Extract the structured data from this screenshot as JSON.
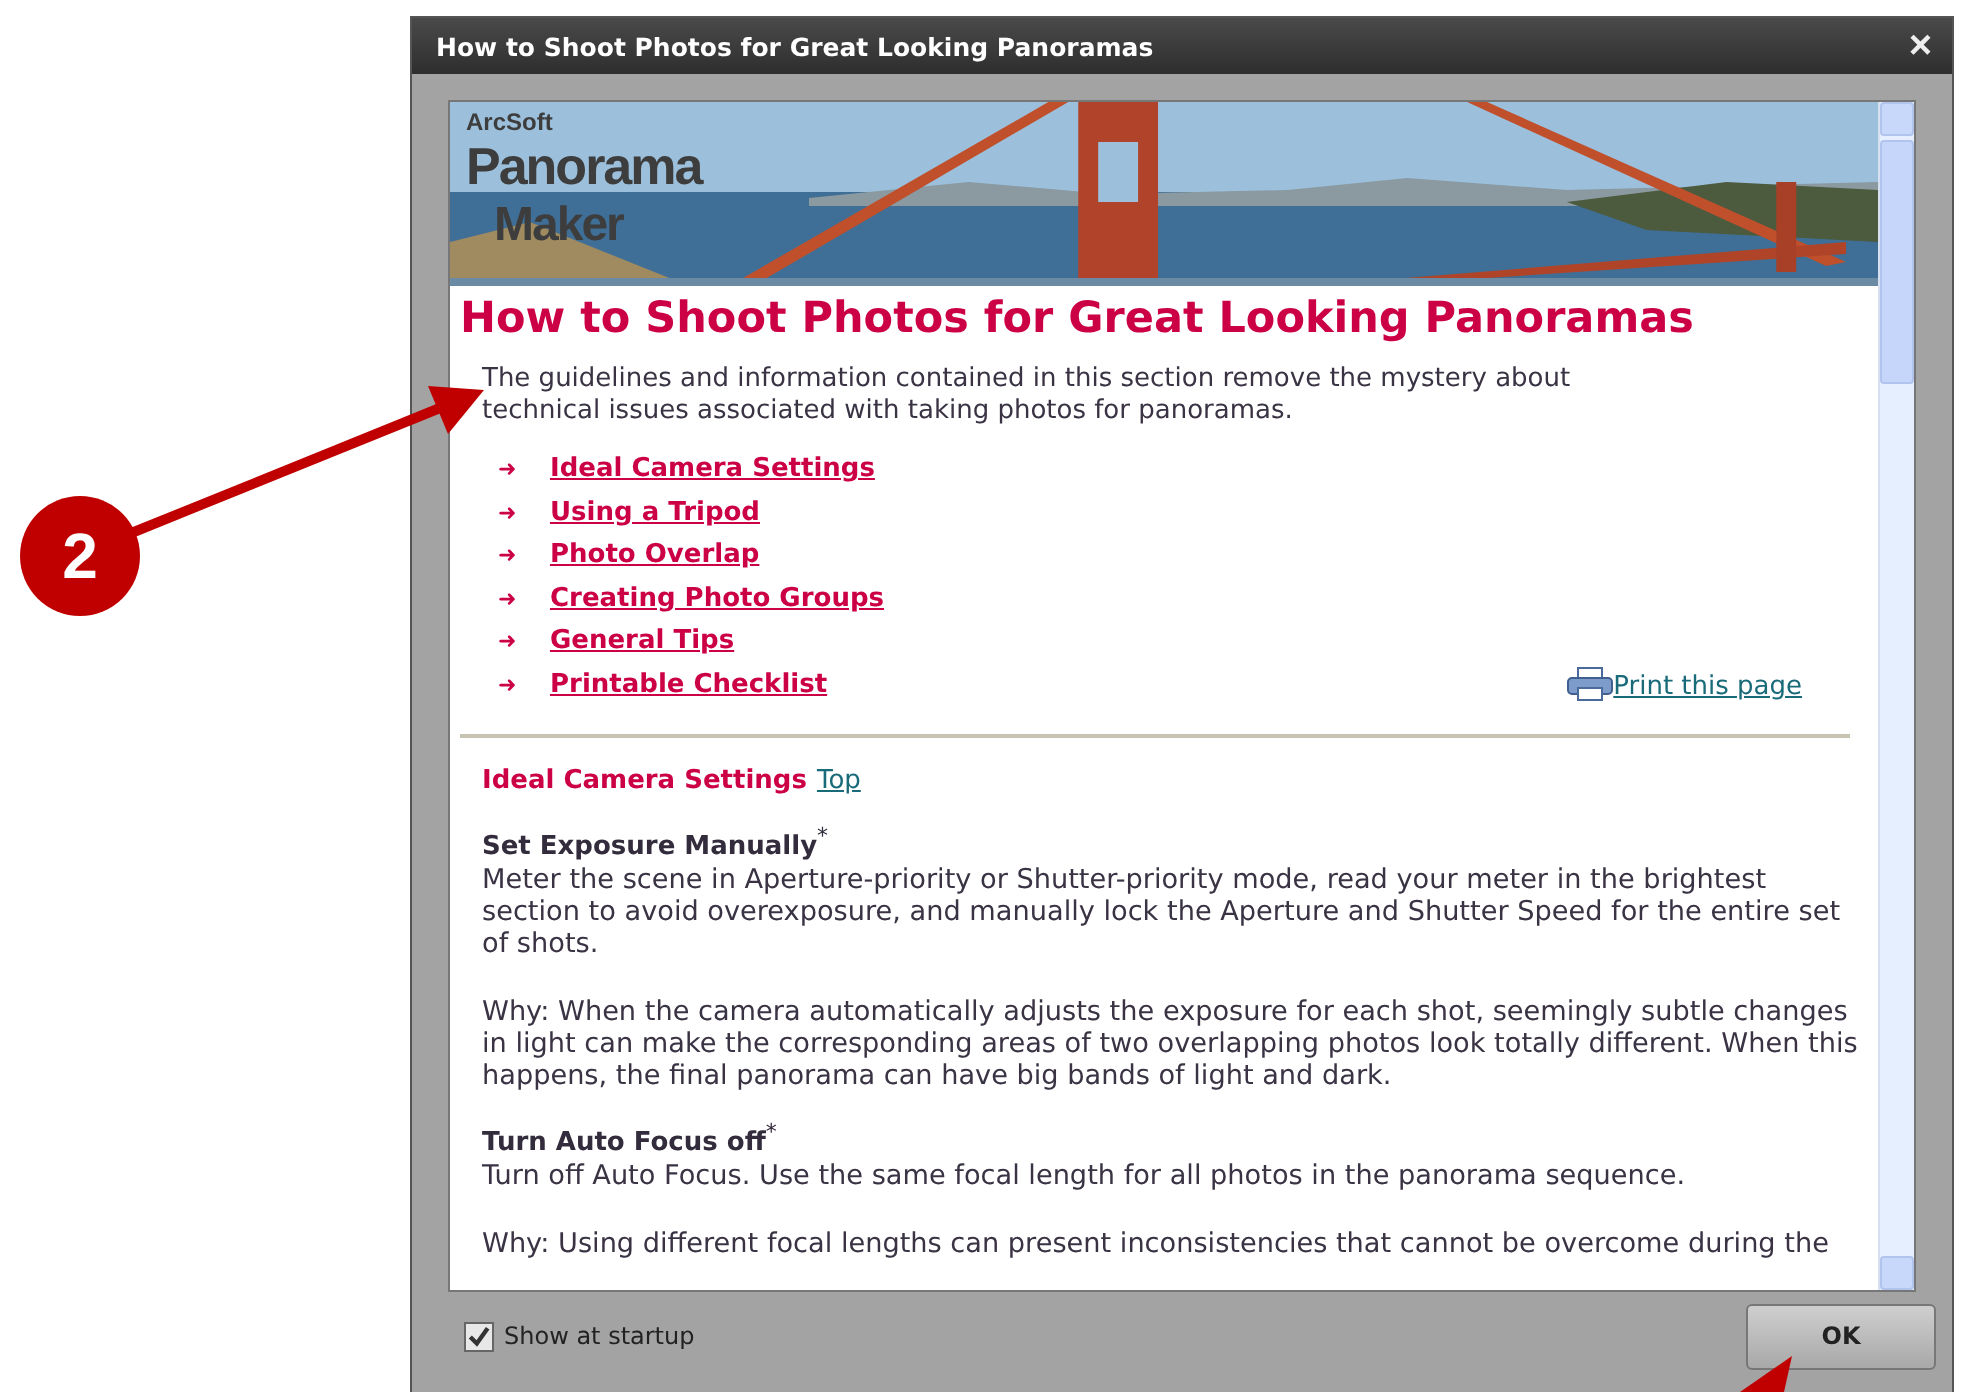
{
  "callout": {
    "label": "2"
  },
  "window": {
    "title": "How to Shoot Photos for Great Looking Panoramas",
    "close": "×"
  },
  "banner": {
    "kind": "picture",
    "logo": [
      "ArcSoft",
      "Panorama",
      "Maker"
    ]
  },
  "page": {
    "heading": "How to Shoot Photos for Great Looking Panoramas",
    "intro": "The guidelines and information contained in this section remove the mystery about technical issues associated with taking photos for panoramas.",
    "links": [
      {
        "bullet": "➜",
        "label": "Ideal Camera Settings"
      },
      {
        "bullet": "➜",
        "label": "Using a Tripod"
      },
      {
        "bullet": "➜",
        "label": "Photo Overlap"
      },
      {
        "bullet": "➜",
        "label": "Creating Photo Groups"
      },
      {
        "bullet": "➜",
        "label": "General Tips"
      },
      {
        "bullet": "➜",
        "label": "Printable Checklist"
      }
    ],
    "print_link": "Print this page",
    "section": {
      "title": "Ideal Camera Settings",
      "top_link": "Top",
      "items": [
        {
          "heading": "Set Exposure Manually$^{*}$",
          "paragraphs": [
            "Meter the scene in Aperture-priority or Shutter-priority mode, read your meter in the brightest section to avoid overexposure, and manually lock the Aperture and Shutter Speed for the entire set of shots.",
            "Why: When the camera automatically adjusts the exposure for each shot, seemingly subtle changes in light can make the corresponding areas of two overlapping photos look totally different. When this happens, the final panorama can have big bands of light and dark."
          ]
        },
        {
          "heading": "Turn Auto Focus off$^{*}$",
          "paragraphs": [
            "Turn off Auto Focus. Use the same focal length for all photos in the panorama sequence.",
            "Why: Using different focal lengths can present inconsistencies that cannot be overcome during the"
          ]
        }
      ]
    }
  },
  "footer": {
    "show_at_startup": {
      "label": "Show at startup",
      "checked": true
    },
    "ok_button": "OK"
  }
}
